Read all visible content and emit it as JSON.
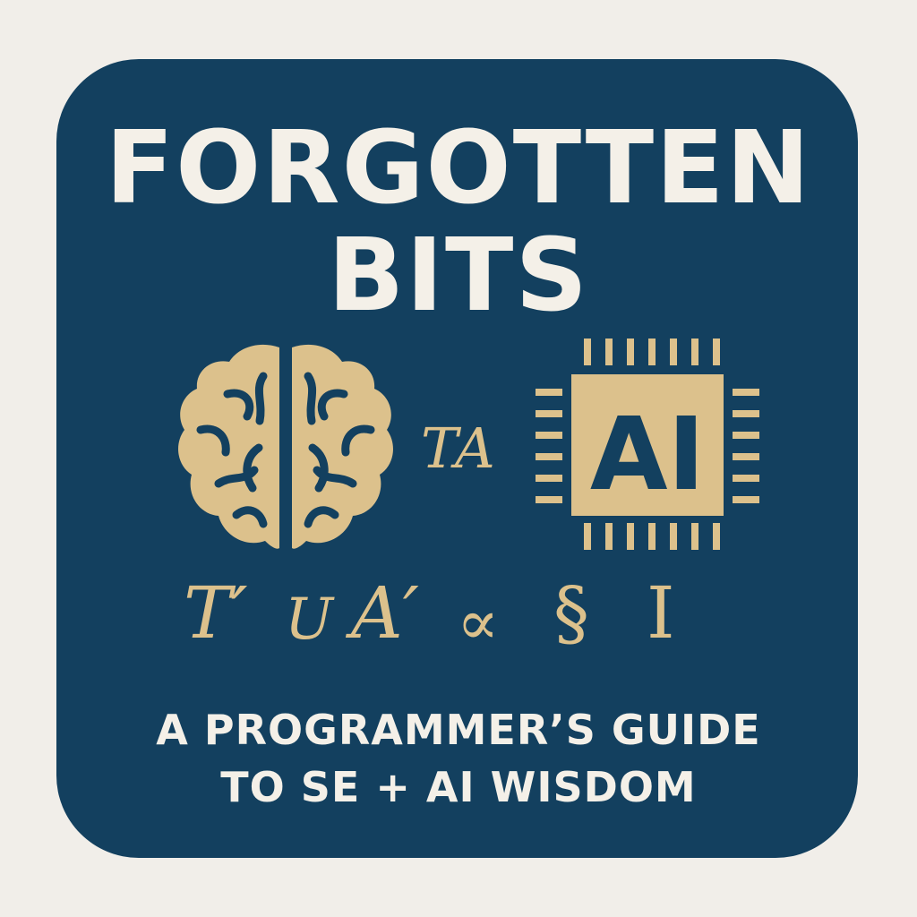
{
  "title": {
    "line1": "FORGOTTEN",
    "line2": "BITS"
  },
  "subtitle": {
    "line1": "A PROGRAMMER’S GUIDE",
    "line2": "TO SE + AI WISDOM"
  },
  "glyphs": {
    "ta": "TA",
    "chip_label": "AI",
    "symbols": [
      "T′",
      "U",
      "A′",
      "∝",
      "§",
      "Ⅰ"
    ]
  },
  "icons": {
    "brain": "brain-icon",
    "chip": "cpu-chip-icon"
  },
  "colors": {
    "background": "#f1eee9",
    "card": "#13405f",
    "title_text": "#f4f0e8",
    "accent": "#dcc18c"
  }
}
